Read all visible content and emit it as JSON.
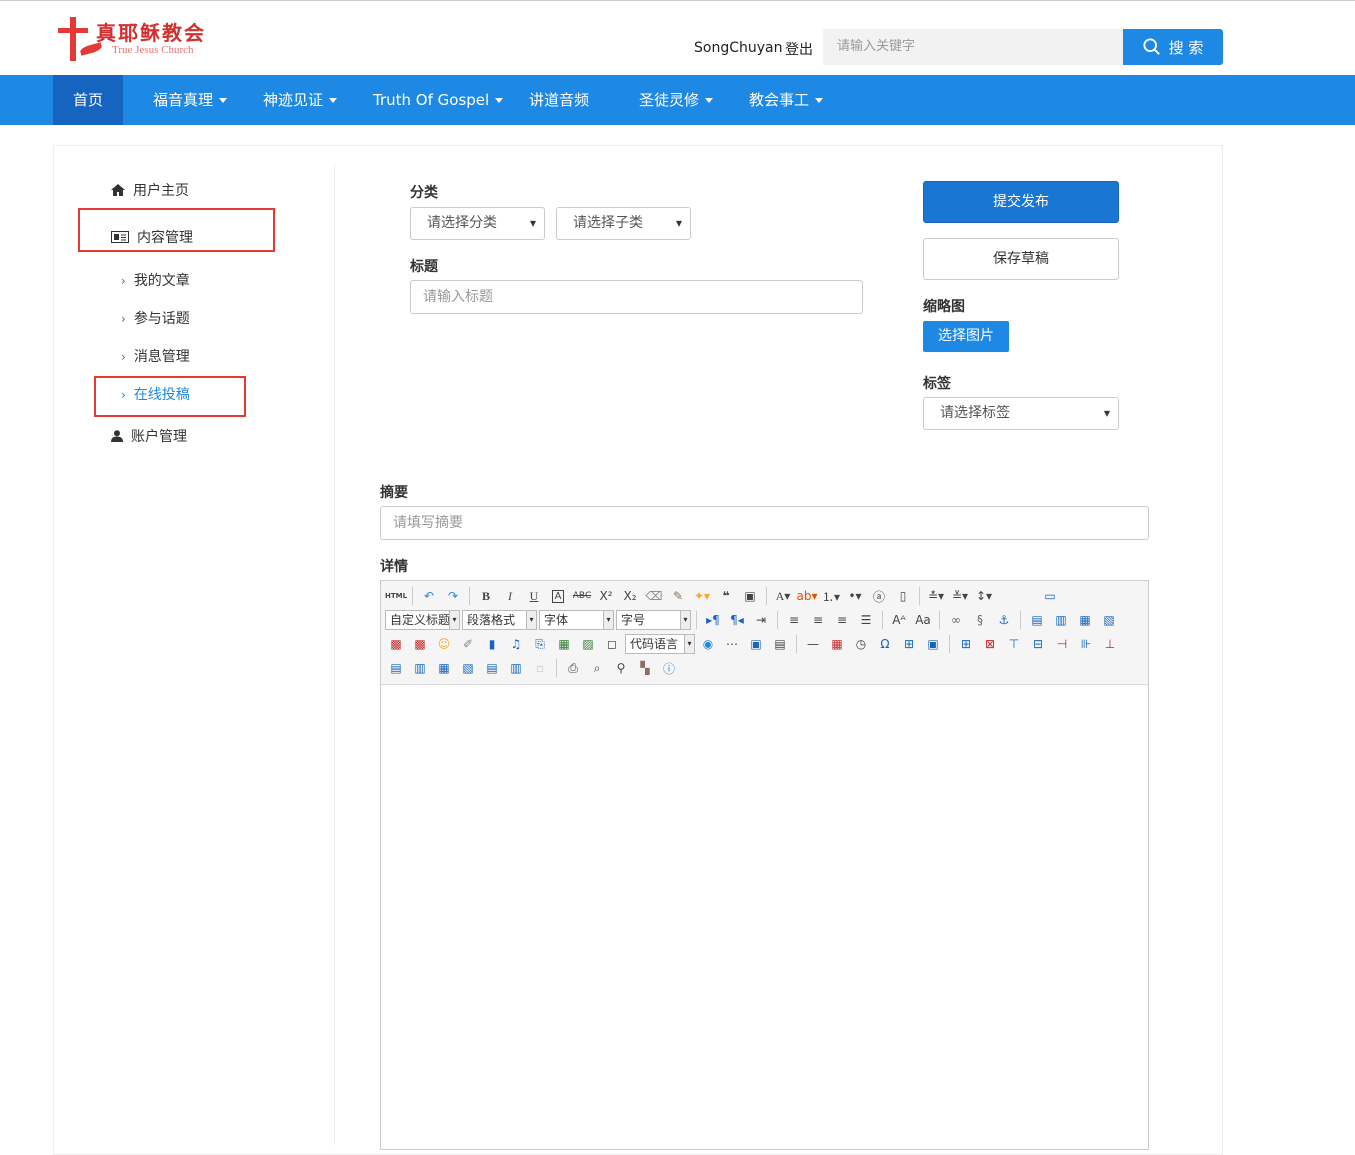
{
  "header": {
    "logo_cn": "真耶稣教会",
    "logo_en": "True Jesus Church",
    "username": "SongChuyan",
    "logout": "登出",
    "search_placeholder": "请输入关键字",
    "search_button": "搜 索"
  },
  "nav": {
    "items": [
      {
        "label": "首页"
      },
      {
        "label": "福音真理"
      },
      {
        "label": "神迹见证"
      },
      {
        "label": "Truth Of Gospel"
      },
      {
        "label": "讲道音频"
      },
      {
        "label": "圣徒灵修"
      },
      {
        "label": "教会事工"
      }
    ]
  },
  "sidebar": {
    "home": "用户主页",
    "content": "内容管理",
    "sub": [
      "我的文章",
      "参与话题",
      "消息管理",
      "在线投稿"
    ],
    "account": "账户管理"
  },
  "form": {
    "category_label": "分类",
    "category_placeholder": "请选择分类",
    "subcategory_placeholder": "请选择子类",
    "title_label": "标题",
    "title_placeholder": "请输入标题",
    "submit": "提交发布",
    "save_draft": "保存草稿",
    "thumbnail_label": "缩略图",
    "choose_image": "选择图片",
    "tags_label": "标签",
    "tags_placeholder": "请选择标签",
    "summary_label": "摘要",
    "summary_placeholder": "请填写摘要",
    "detail_label": "详情"
  },
  "editor": {
    "combos": {
      "custom_title": "自定义标题",
      "paragraph": "段落格式",
      "font": "字体",
      "size": "字号",
      "code_lang": "代码语言"
    },
    "html_label": "HTML"
  },
  "colors": {
    "brand_blue": "#1e88e5",
    "active_nav": "#1565c0",
    "highlight_red": "#e53935"
  }
}
